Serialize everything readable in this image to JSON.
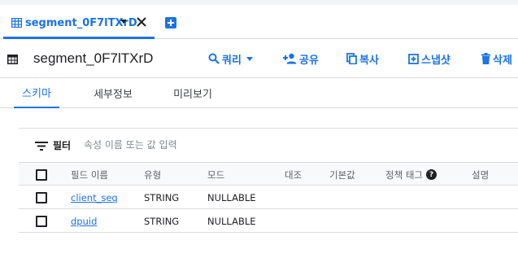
{
  "tab": {
    "label": "segment_0F7lTXrD",
    "icon": "table-icon"
  },
  "header": {
    "title": "segment_0F7lTXrD",
    "actions": {
      "query": "쿼리",
      "share": "공유",
      "copy": "복사",
      "snapshot": "스냅샷",
      "delete": "삭제"
    }
  },
  "subtabs": [
    "스키마",
    "세부정보",
    "미리보기"
  ],
  "filter": {
    "label": "필터",
    "placeholder": "속성 이름 또는 값 입력"
  },
  "table": {
    "columns": [
      "필드 이름",
      "유형",
      "모드",
      "대조",
      "기본값",
      "정책 태그",
      "설명"
    ],
    "rows": [
      {
        "name": "client_seq",
        "type": "STRING",
        "mode": "NULLABLE"
      },
      {
        "name": "dpuid",
        "type": "STRING",
        "mode": "NULLABLE"
      }
    ]
  },
  "colors": {
    "accent": "#1a73e8",
    "text": "#202124",
    "muted": "#5f6368",
    "border": "#dadce0"
  }
}
